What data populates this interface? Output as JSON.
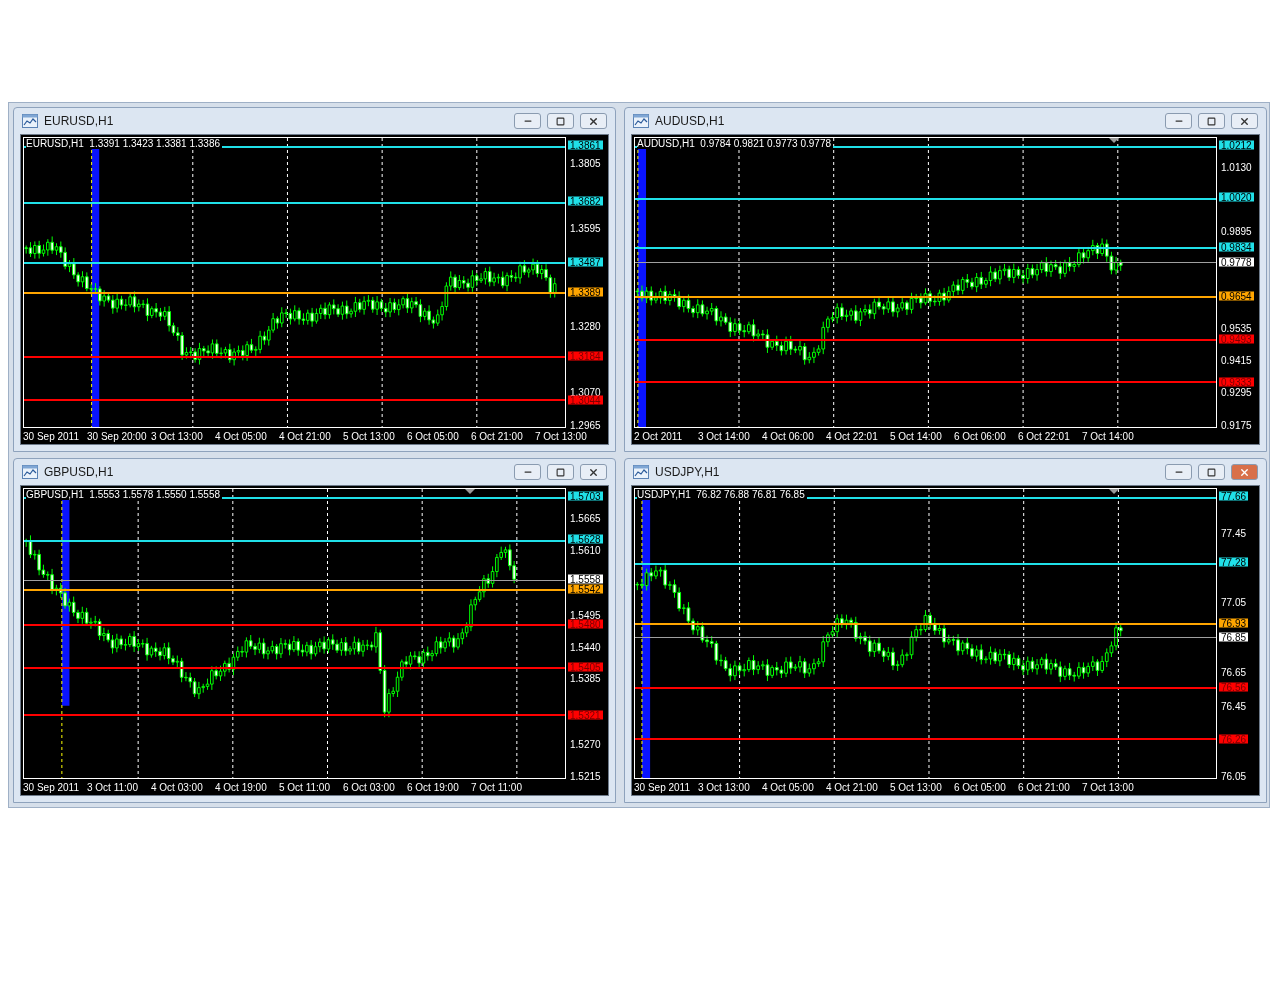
{
  "windows": [
    {
      "title": "EURUSD,H1",
      "active": false,
      "chart": {
        "header": "EURUSD,H1  1.3391 1.3423 1.3381 1.3386",
        "shift_marker": false,
        "price_ticks": [
          "1.3805",
          "1.3595",
          "1.3280",
          "1.3070",
          "1.2965"
        ],
        "levels": [
          {
            "label": "1.3861",
            "kind": "resistance",
            "color": "#20e0e8"
          },
          {
            "label": "1.3682",
            "kind": "resistance",
            "color": "#20e0e8"
          },
          {
            "label": "1.3487",
            "kind": "resistance",
            "color": "#20e0e8"
          },
          {
            "label": "1.3389",
            "kind": "pivot",
            "color": "#ffa500"
          },
          {
            "label": "1.3184",
            "kind": "support",
            "color": "#ff0000"
          },
          {
            "label": "1.3044",
            "kind": "support",
            "color": "#ff0000"
          }
        ],
        "time_labels": [
          "30 Sep 2011",
          "30 Sep 20:00",
          "3 Oct 13:00",
          "4 Oct 05:00",
          "4 Oct 21:00",
          "5 Oct 13:00",
          "6 Oct 05:00",
          "6 Oct 21:00",
          "7 Oct 13:00"
        ]
      }
    },
    {
      "title": "AUDUSD,H1",
      "active": false,
      "chart": {
        "header": "AUDUSD,H1  0.9784 0.9821 0.9773 0.9778",
        "shift_marker": true,
        "price_ticks": [
          "1.0130",
          "0.9895",
          "0.9535",
          "0.9415",
          "0.9295",
          "0.9175"
        ],
        "levels": [
          {
            "label": "1.0212",
            "kind": "resistance",
            "color": "#20e0e8"
          },
          {
            "label": "1.0020",
            "kind": "resistance",
            "color": "#20e0e8"
          },
          {
            "label": "0.9834",
            "kind": "resistance",
            "color": "#20e0e8"
          },
          {
            "label": "0.9778",
            "kind": "bid",
            "color": "#a0a0a0"
          },
          {
            "label": "0.9654",
            "kind": "pivot",
            "color": "#ffa500"
          },
          {
            "label": "0.9493",
            "kind": "support",
            "color": "#ff0000"
          },
          {
            "label": "0.9333",
            "kind": "support",
            "color": "#ff0000"
          }
        ],
        "time_labels": [
          "2 Oct 2011",
          "3 Oct 14:00",
          "4 Oct 06:00",
          "4 Oct 22:01",
          "5 Oct 14:00",
          "6 Oct 06:00",
          "6 Oct 22:01",
          "7 Oct 14:00"
        ]
      }
    },
    {
      "title": "GBPUSD,H1",
      "active": false,
      "chart": {
        "header": "GBPUSD,H1  1.5553 1.5578 1.5550 1.5558",
        "shift_marker": true,
        "price_ticks": [
          "1.5665",
          "1.5610",
          "1.5495",
          "1.5440",
          "1.5385",
          "1.5270",
          "1.5215"
        ],
        "levels": [
          {
            "label": "1.5703",
            "kind": "resistance",
            "color": "#20e0e8"
          },
          {
            "label": "1.5628",
            "kind": "resistance",
            "color": "#20e0e8"
          },
          {
            "label": "1.5558",
            "kind": "bid",
            "color": "#a0a0a0"
          },
          {
            "label": "1.5542",
            "kind": "pivot",
            "color": "#ffa500"
          },
          {
            "label": "1.5480",
            "kind": "support",
            "color": "#ff0000"
          },
          {
            "label": "1.5405",
            "kind": "support",
            "color": "#ff0000"
          },
          {
            "label": "1.5321",
            "kind": "support",
            "color": "#ff0000"
          }
        ],
        "time_labels": [
          "30 Sep 2011",
          "3 Oct 11:00",
          "4 Oct 03:00",
          "4 Oct 19:00",
          "5 Oct 11:00",
          "6 Oct 03:00",
          "6 Oct 19:00",
          "7 Oct 11:00"
        ]
      }
    },
    {
      "title": "USDJPY,H1",
      "active": true,
      "chart": {
        "header": "USDJPY,H1  76.82 76.88 76.81 76.85",
        "shift_marker": true,
        "price_ticks": [
          "77.45",
          "77.05",
          "76.65",
          "76.45",
          "76.05"
        ],
        "levels": [
          {
            "label": "77.66",
            "kind": "resistance",
            "color": "#20e0e8"
          },
          {
            "label": "77.28",
            "kind": "resistance",
            "color": "#20e0e8"
          },
          {
            "label": "76.93",
            "kind": "pivot",
            "color": "#ffa500"
          },
          {
            "label": "76.85",
            "kind": "bid",
            "color": "#a0a0a0"
          },
          {
            "label": "76.56",
            "kind": "support",
            "color": "#ff0000"
          },
          {
            "label": "76.26",
            "kind": "support",
            "color": "#ff0000"
          }
        ],
        "time_labels": [
          "30 Sep 2011",
          "3 Oct 13:00",
          "4 Oct 05:00",
          "4 Oct 21:00",
          "5 Oct 13:00",
          "6 Oct 05:00",
          "6 Oct 21:00",
          "7 Oct 13:00"
        ]
      }
    }
  ]
}
